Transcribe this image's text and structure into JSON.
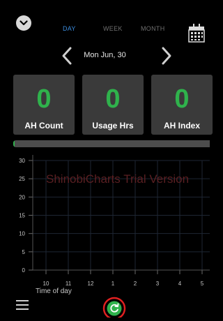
{
  "tabs": [
    {
      "label": "DAY",
      "active": true
    },
    {
      "label": "WEEK",
      "active": false
    },
    {
      "label": "MONTH",
      "active": false
    }
  ],
  "date": "Mon Jun, 30",
  "metrics": [
    {
      "value": "0",
      "label": "AH Count"
    },
    {
      "value": "0",
      "label": "Usage Hrs"
    },
    {
      "value": "0",
      "label": "AH Index"
    }
  ],
  "progress_fraction": 0.006,
  "chart_watermark": "ShinobiCharts Trial Version",
  "chart_data": {
    "type": "line",
    "title": "",
    "xlabel": "Time of day",
    "ylabel": "",
    "x_ticks": [
      "10",
      "11",
      "12",
      "1",
      "2",
      "3",
      "4",
      "5"
    ],
    "y_ticks": [
      "30",
      "25",
      "20",
      "15",
      "10",
      "5",
      "0"
    ],
    "ylim": [
      0,
      30
    ],
    "series": [],
    "grid": true
  },
  "colors": {
    "accent": "#2fb24c",
    "active_tab": "#3b8ddf",
    "refresh_ring": "#e02020"
  },
  "icons": {
    "collapse": "chevron-down-icon",
    "calendar": "calendar-icon",
    "menu": "hamburger-menu-icon",
    "refresh": "refresh-icon"
  }
}
